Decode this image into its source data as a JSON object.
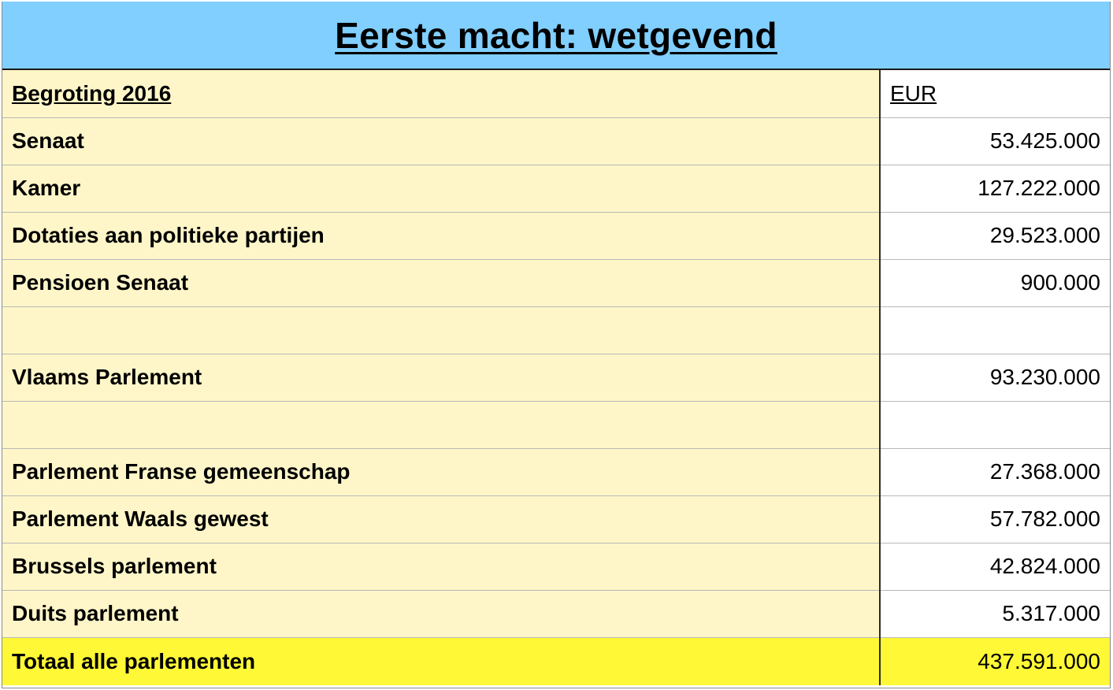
{
  "title": "Eerste macht: wetgevend",
  "header": {
    "label": "Begroting 2016",
    "unit": "EUR"
  },
  "rows": [
    {
      "label": "Senaat",
      "value": "53.425.000"
    },
    {
      "label": "Kamer",
      "value": "127.222.000"
    },
    {
      "label": "Dotaties aan politieke partijen",
      "value": "29.523.000"
    },
    {
      "label": "Pensioen Senaat",
      "value": "900.000"
    },
    {
      "label": "",
      "value": ""
    },
    {
      "label": "Vlaams Parlement",
      "value": "93.230.000"
    },
    {
      "label": "",
      "value": ""
    },
    {
      "label": "Parlement Franse gemeenschap",
      "value": "27.368.000"
    },
    {
      "label": "Parlement Waals gewest",
      "value": "57.782.000"
    },
    {
      "label": "Brussels parlement",
      "value": "42.824.000"
    },
    {
      "label": "Duits parlement",
      "value": "5.317.000"
    }
  ],
  "total": {
    "label": "Totaal alle parlementen",
    "value": "437.591.000"
  },
  "colors": {
    "title_background": "#80cfff",
    "label_background": "#fef6c8",
    "total_background": "#fef836"
  }
}
